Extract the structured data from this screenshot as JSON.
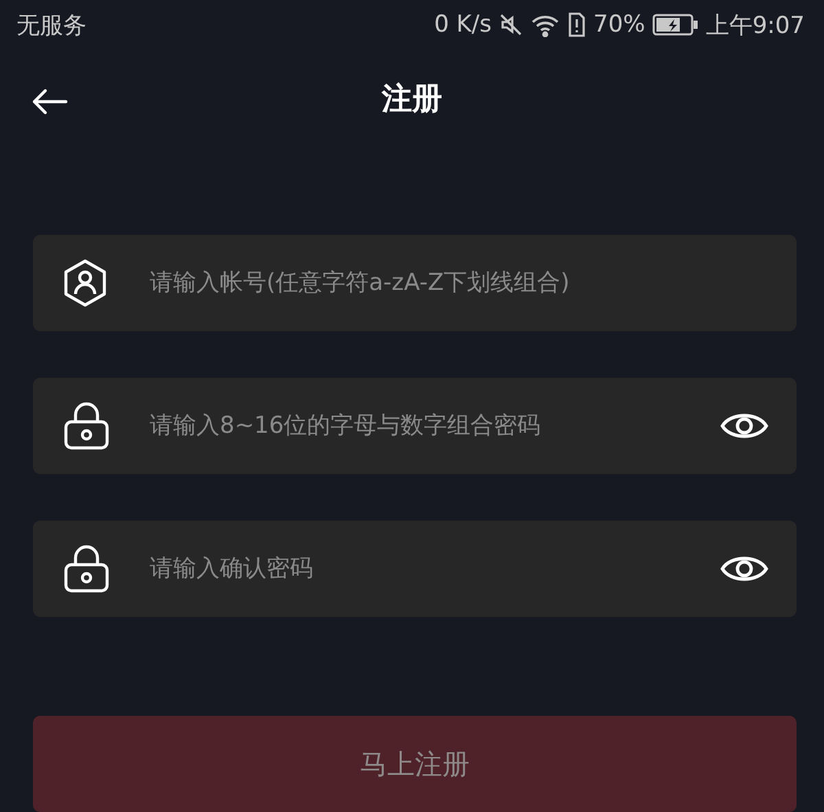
{
  "status_bar": {
    "carrier": "无服务",
    "speed": "0 K/s",
    "battery": "70%",
    "time": "上午9:07"
  },
  "header": {
    "title": "注册"
  },
  "fields": [
    {
      "kind": "account",
      "placeholder": "请输入帐号(任意字符a-zA-Z下划线组合)"
    },
    {
      "kind": "password",
      "placeholder": "请输入8~16位的字母与数字组合密码"
    },
    {
      "kind": "password",
      "placeholder": "请输入确认密码"
    }
  ],
  "submit": {
    "label": "马上注册",
    "disabled": true
  }
}
